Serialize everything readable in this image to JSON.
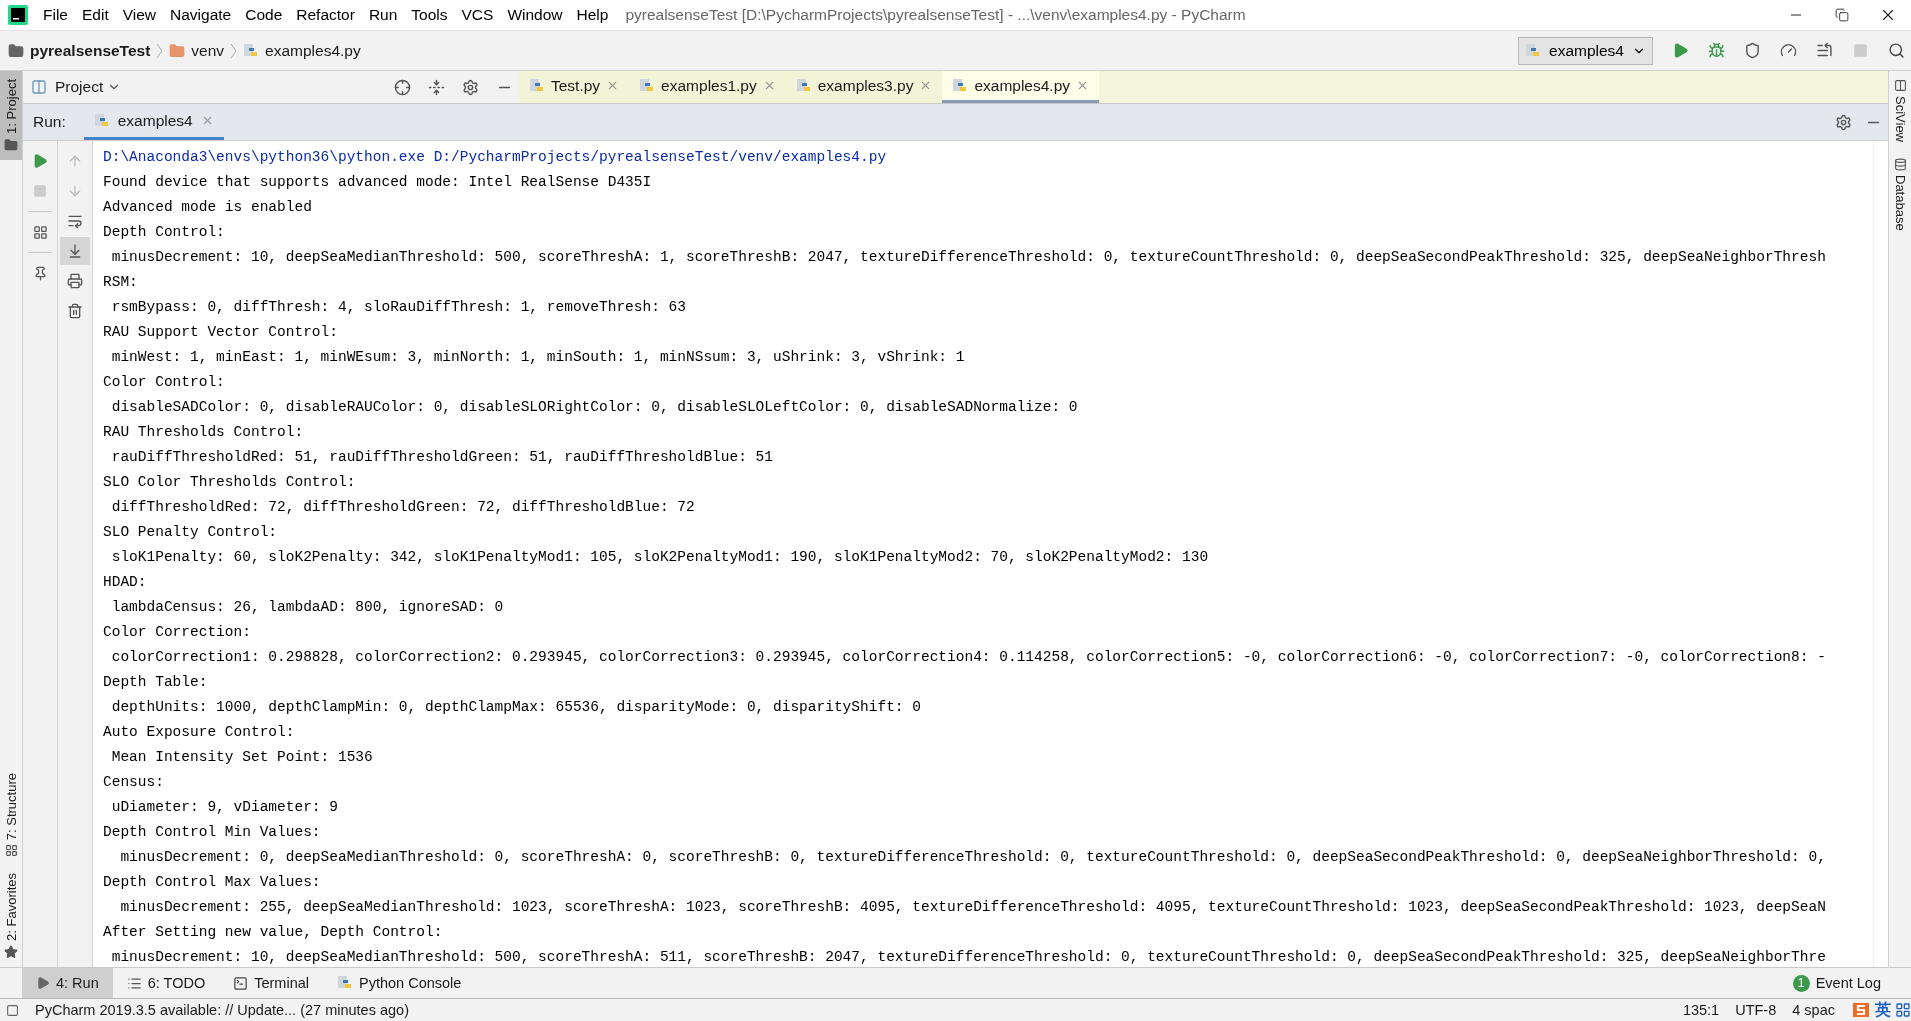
{
  "menu_bar": {
    "items": [
      "File",
      "Edit",
      "View",
      "Navigate",
      "Code",
      "Refactor",
      "Run",
      "Tools",
      "VCS",
      "Window",
      "Help"
    ],
    "title": "pyrealsenseTest [D:\\PycharmProjects\\pyrealsenseTest] - ...\\venv\\examples4.py - PyCharm"
  },
  "nav_bar": {
    "breadcrumbs": [
      {
        "label": "pyrealsenseTest",
        "kind": "project"
      },
      {
        "label": "venv",
        "kind": "folder"
      },
      {
        "label": "examples4.py",
        "kind": "file"
      }
    ],
    "run_config": "examples4"
  },
  "left_stripe": [
    {
      "label": "1: Project",
      "kind": "project",
      "selected": true
    },
    {
      "label": "7: Structure",
      "kind": "structure",
      "selected": false
    },
    {
      "label": "2: Favorites",
      "kind": "favorites",
      "selected": false
    }
  ],
  "project_header": {
    "title": "Project"
  },
  "editor_tabs": [
    {
      "label": "Test.py",
      "selected": false
    },
    {
      "label": "examples1.py",
      "selected": false
    },
    {
      "label": "examples3.py",
      "selected": false
    },
    {
      "label": "examples4.py",
      "selected": true
    }
  ],
  "run_panel": {
    "label": "Run:",
    "tabs": [
      {
        "label": "examples4",
        "selected": true
      }
    ]
  },
  "console": {
    "lines": [
      {
        "kind": "command",
        "text": "D:\\Anaconda3\\envs\\python36\\python.exe D:/PycharmProjects/pyrealsenseTest/venv/examples4.py"
      },
      {
        "kind": "output",
        "text": "Found device that supports advanced mode: Intel RealSense D435I"
      },
      {
        "kind": "output",
        "text": "Advanced mode is enabled"
      },
      {
        "kind": "output",
        "text": "Depth Control:"
      },
      {
        "kind": "output",
        "text": " minusDecrement: 10, deepSeaMedianThreshold: 500, scoreThreshA: 1, scoreThreshB: 2047, textureDifferenceThreshold: 0, textureCountThreshold: 0, deepSeaSecondPeakThreshold: 325, deepSeaNeighborThresh"
      },
      {
        "kind": "output",
        "text": "RSM:"
      },
      {
        "kind": "output",
        "text": " rsmBypass: 0, diffThresh: 4, sloRauDiffThresh: 1, removeThresh: 63"
      },
      {
        "kind": "output",
        "text": "RAU Support Vector Control:"
      },
      {
        "kind": "output",
        "text": " minWest: 1, minEast: 1, minWEsum: 3, minNorth: 1, minSouth: 1, minNSsum: 3, uShrink: 3, vShrink: 1"
      },
      {
        "kind": "output",
        "text": "Color Control:"
      },
      {
        "kind": "output",
        "text": " disableSADColor: 0, disableRAUColor: 0, disableSLORightColor: 0, disableSLOLeftColor: 0, disableSADNormalize: 0"
      },
      {
        "kind": "output",
        "text": "RAU Thresholds Control:"
      },
      {
        "kind": "output",
        "text": " rauDiffThresholdRed: 51, rauDiffThresholdGreen: 51, rauDiffThresholdBlue: 51"
      },
      {
        "kind": "output",
        "text": "SLO Color Thresholds Control:"
      },
      {
        "kind": "output",
        "text": " diffThresholdRed: 72, diffThresholdGreen: 72, diffThresholdBlue: 72"
      },
      {
        "kind": "output",
        "text": "SLO Penalty Control:"
      },
      {
        "kind": "output",
        "text": " sloK1Penalty: 60, sloK2Penalty: 342, sloK1PenaltyMod1: 105, sloK2PenaltyMod1: 190, sloK1PenaltyMod2: 70, sloK2PenaltyMod2: 130"
      },
      {
        "kind": "output",
        "text": "HDAD:"
      },
      {
        "kind": "output",
        "text": " lambdaCensus: 26, lambdaAD: 800, ignoreSAD: 0"
      },
      {
        "kind": "output",
        "text": "Color Correction:"
      },
      {
        "kind": "output",
        "text": " colorCorrection1: 0.298828, colorCorrection2: 0.293945, colorCorrection3: 0.293945, colorCorrection4: 0.114258, colorCorrection5: -0, colorCorrection6: -0, colorCorrection7: -0, colorCorrection8: -"
      },
      {
        "kind": "output",
        "text": "Depth Table:"
      },
      {
        "kind": "output",
        "text": " depthUnits: 1000, depthClampMin: 0, depthClampMax: 65536, disparityMode: 0, disparityShift: 0"
      },
      {
        "kind": "output",
        "text": "Auto Exposure Control:"
      },
      {
        "kind": "output",
        "text": " Mean Intensity Set Point: 1536"
      },
      {
        "kind": "output",
        "text": "Census:"
      },
      {
        "kind": "output",
        "text": " uDiameter: 9, vDiameter: 9"
      },
      {
        "kind": "output",
        "text": "Depth Control Min Values:"
      },
      {
        "kind": "output",
        "text": "  minusDecrement: 0, deepSeaMedianThreshold: 0, scoreThreshA: 0, scoreThreshB: 0, textureDifferenceThreshold: 0, textureCountThreshold: 0, deepSeaSecondPeakThreshold: 0, deepSeaNeighborThreshold: 0,"
      },
      {
        "kind": "output",
        "text": "Depth Control Max Values:"
      },
      {
        "kind": "output",
        "text": "  minusDecrement: 255, deepSeaMedianThreshold: 1023, scoreThreshA: 1023, scoreThreshB: 4095, textureDifferenceThreshold: 4095, textureCountThreshold: 1023, deepSeaSecondPeakThreshold: 1023, deepSeaN"
      },
      {
        "kind": "output",
        "text": "After Setting new value, Depth Control:"
      },
      {
        "kind": "output",
        "text": " minusDecrement: 10, deepSeaMedianThreshold: 500, scoreThreshA: 511, scoreThreshB: 2047, textureDifferenceThreshold: 0, textureCountThreshold: 0, deepSeaSecondPeakThreshold: 325, deepSeaNeighborThre"
      }
    ]
  },
  "right_stripe": [
    {
      "label": "SciView",
      "kind": "sciview"
    },
    {
      "label": "Database",
      "kind": "database"
    }
  ],
  "bottom_tabs": [
    {
      "label": "4: Run",
      "kind": "run",
      "selected": true
    },
    {
      "label": "6: TODO",
      "kind": "todo",
      "selected": false
    },
    {
      "label": "Terminal",
      "kind": "terminal",
      "selected": false
    },
    {
      "label": "Python Console",
      "kind": "python",
      "selected": false
    }
  ],
  "event_log": {
    "label": "Event Log",
    "count": "1"
  },
  "status_bar": {
    "message": "PyCharm 2019.3.5 available: // Update... (27 minutes ago)",
    "position": "135:1",
    "encoding": "UTF-8",
    "indent": "4 spac",
    "ime": "英"
  }
}
